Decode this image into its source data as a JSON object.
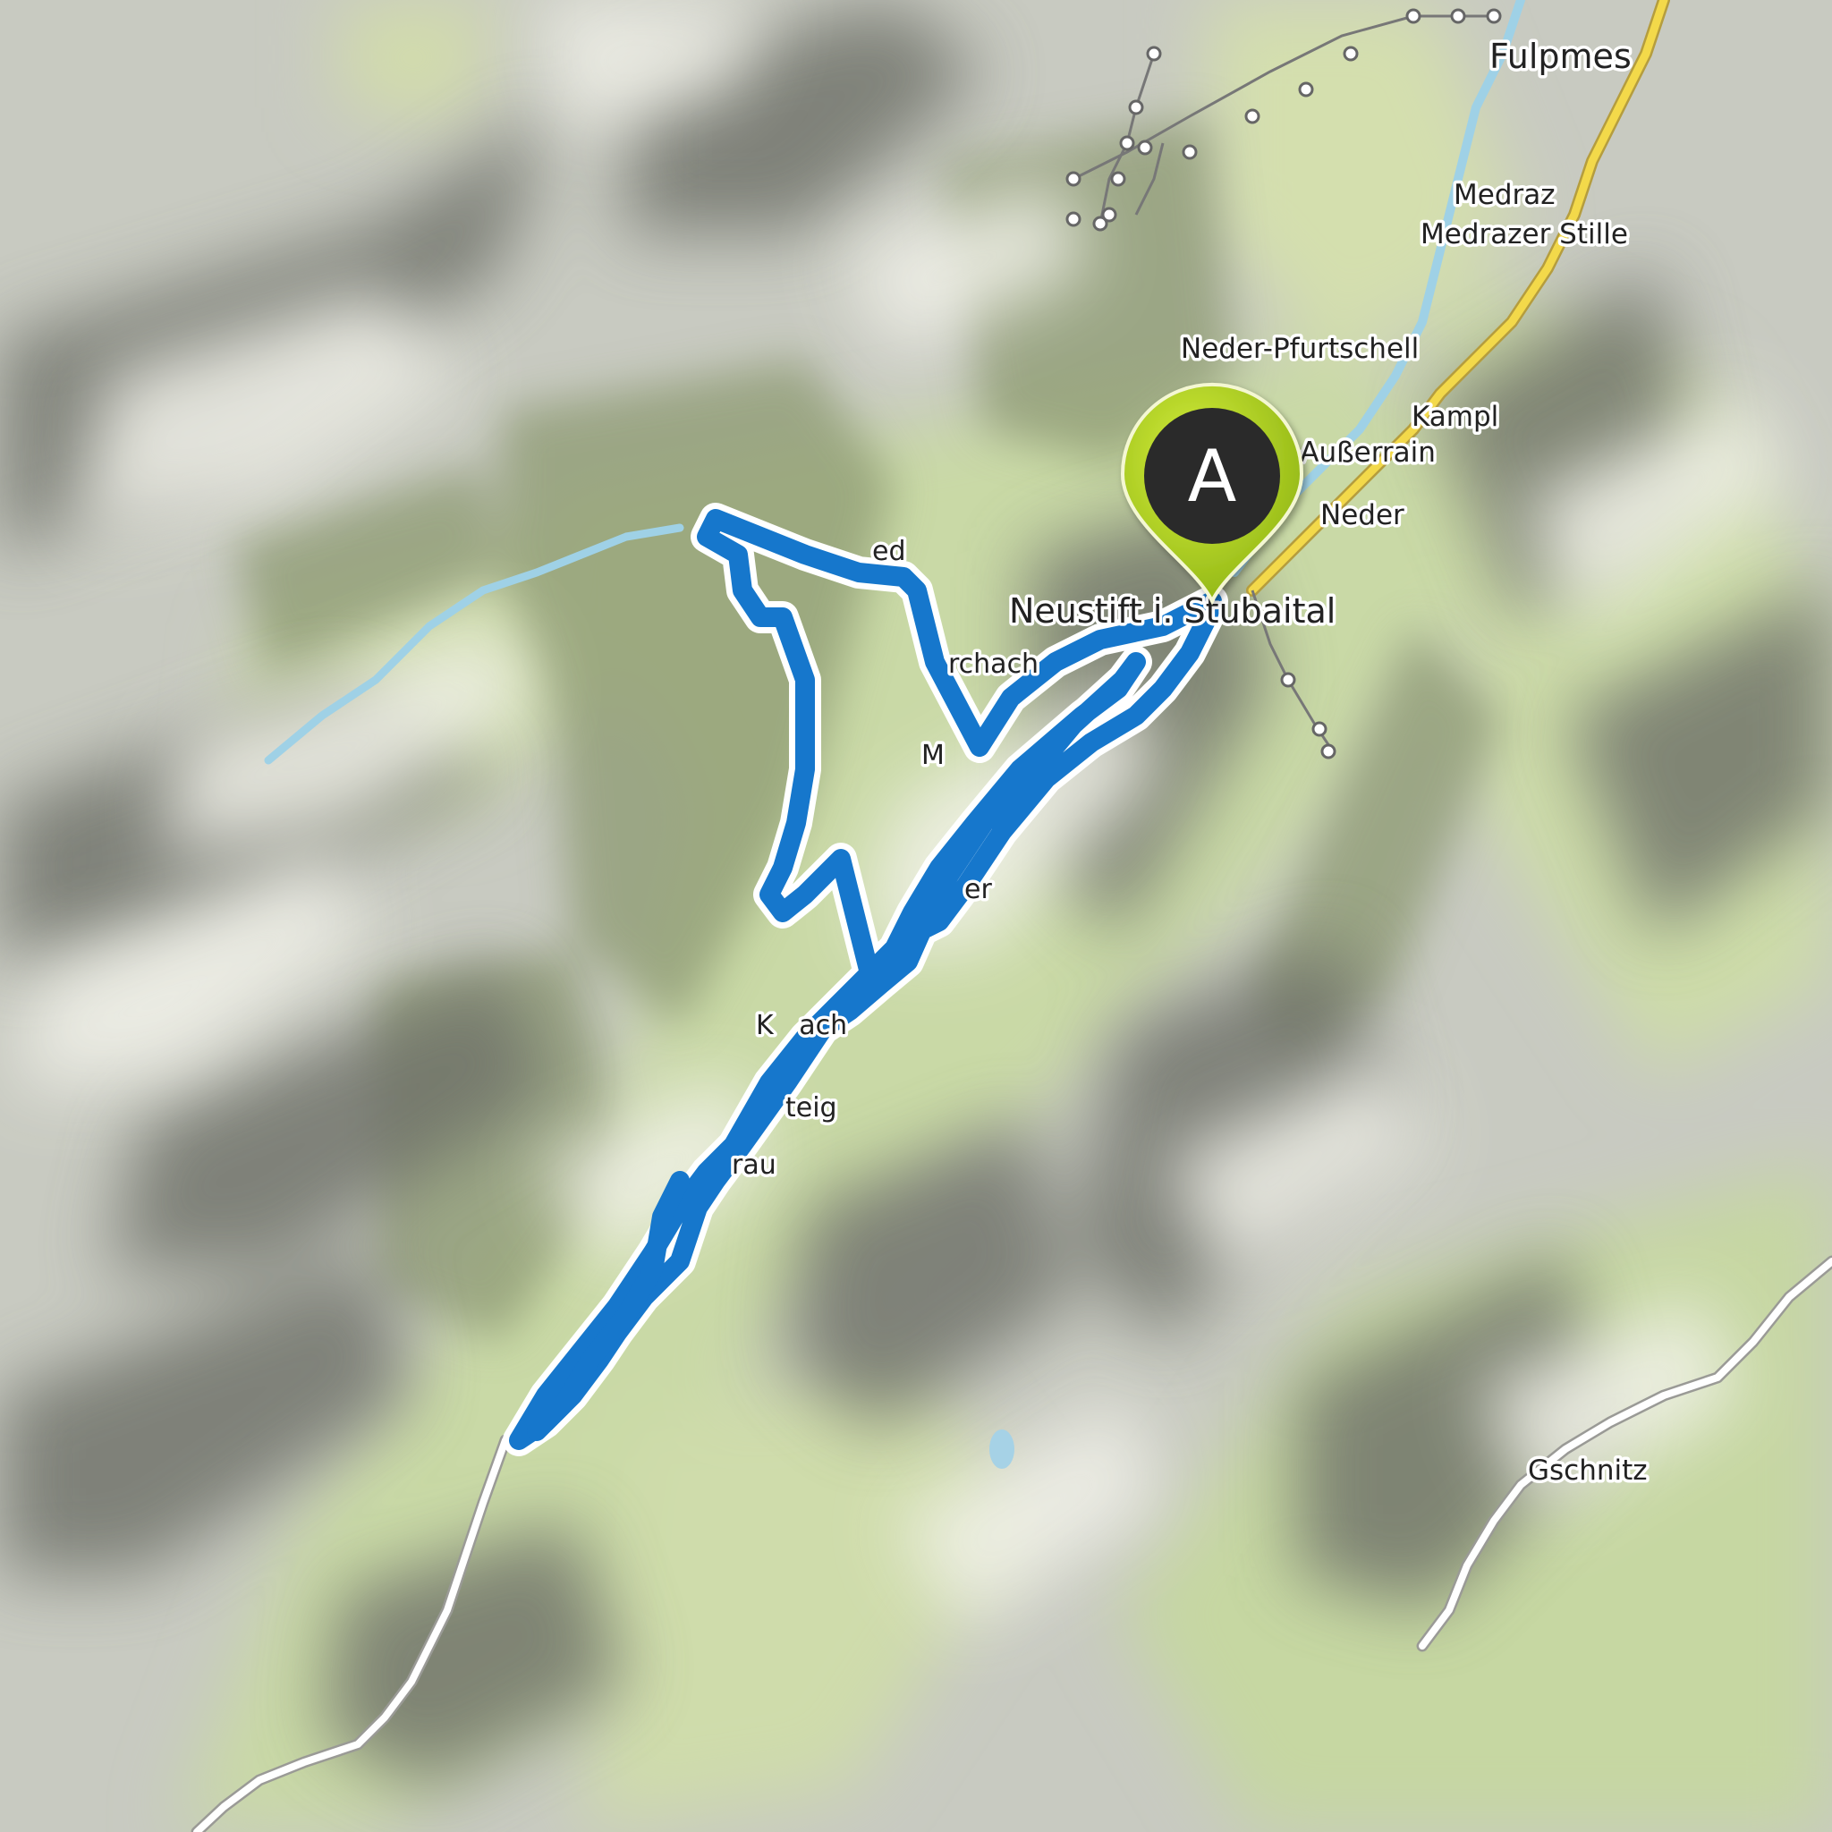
{
  "map": {
    "start_marker": {
      "letter": "A",
      "color": "#a6cc1e",
      "inner_color": "#2b2b2b"
    },
    "route_color": "#1677cc",
    "places": {
      "fulpmes": "Fulpmes",
      "medraz": "Medraz",
      "medrazer_stille": "Medrazer Stille",
      "neder_pfurtschell": "Neder-Pfurtschell",
      "kampl": "Kampl",
      "ausserrain": "r-Außerrain",
      "neder": "Neder",
      "neustift": "Neustift i. Stubaital",
      "ried": "ed",
      "urchach": "rchach",
      "m_partial": "M",
      "er_partial": "er",
      "krasbach": "K   ach",
      "steig": "teig",
      "rau": "rau",
      "gschnitz": "Gschnitz"
    }
  }
}
